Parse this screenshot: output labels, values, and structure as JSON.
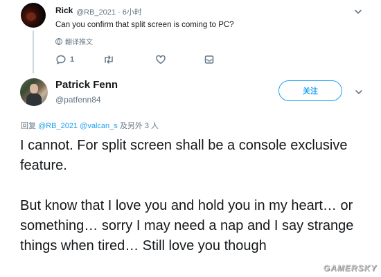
{
  "reply_tweet": {
    "name": "Rick",
    "handle_time": "@RB_2021 · 6小时",
    "text": "Can you confirm that split screen is coming to PC?",
    "translate_label": "翻译推文",
    "reply_count": "1"
  },
  "main_tweet": {
    "name": "Patrick Fenn",
    "handle": "@patfenn84",
    "follow_label": "关注",
    "reply_prefix": "回复 ",
    "reply_mention_1": "@RB_2021",
    "reply_mention_2": "@valcan_s",
    "reply_suffix": " 及另外 3 人",
    "paragraph_1": "I cannot. For split screen shall be a console exclusive feature.",
    "paragraph_2": "But know that I love you and hold you in my heart… or something… sorry  I may need a nap and I say strange things when tired… Still love you though"
  },
  "watermark": "GAMERSKY",
  "icons": {
    "reply": "reply-icon",
    "retweet": "retweet-icon",
    "like": "heart-icon",
    "dm": "mail-icon",
    "menu": "chevron-down-icon",
    "translate": "globe-icon"
  },
  "colors": {
    "accent": "#1da1f2",
    "secondary_text": "#657786",
    "primary_text": "#14171a"
  }
}
